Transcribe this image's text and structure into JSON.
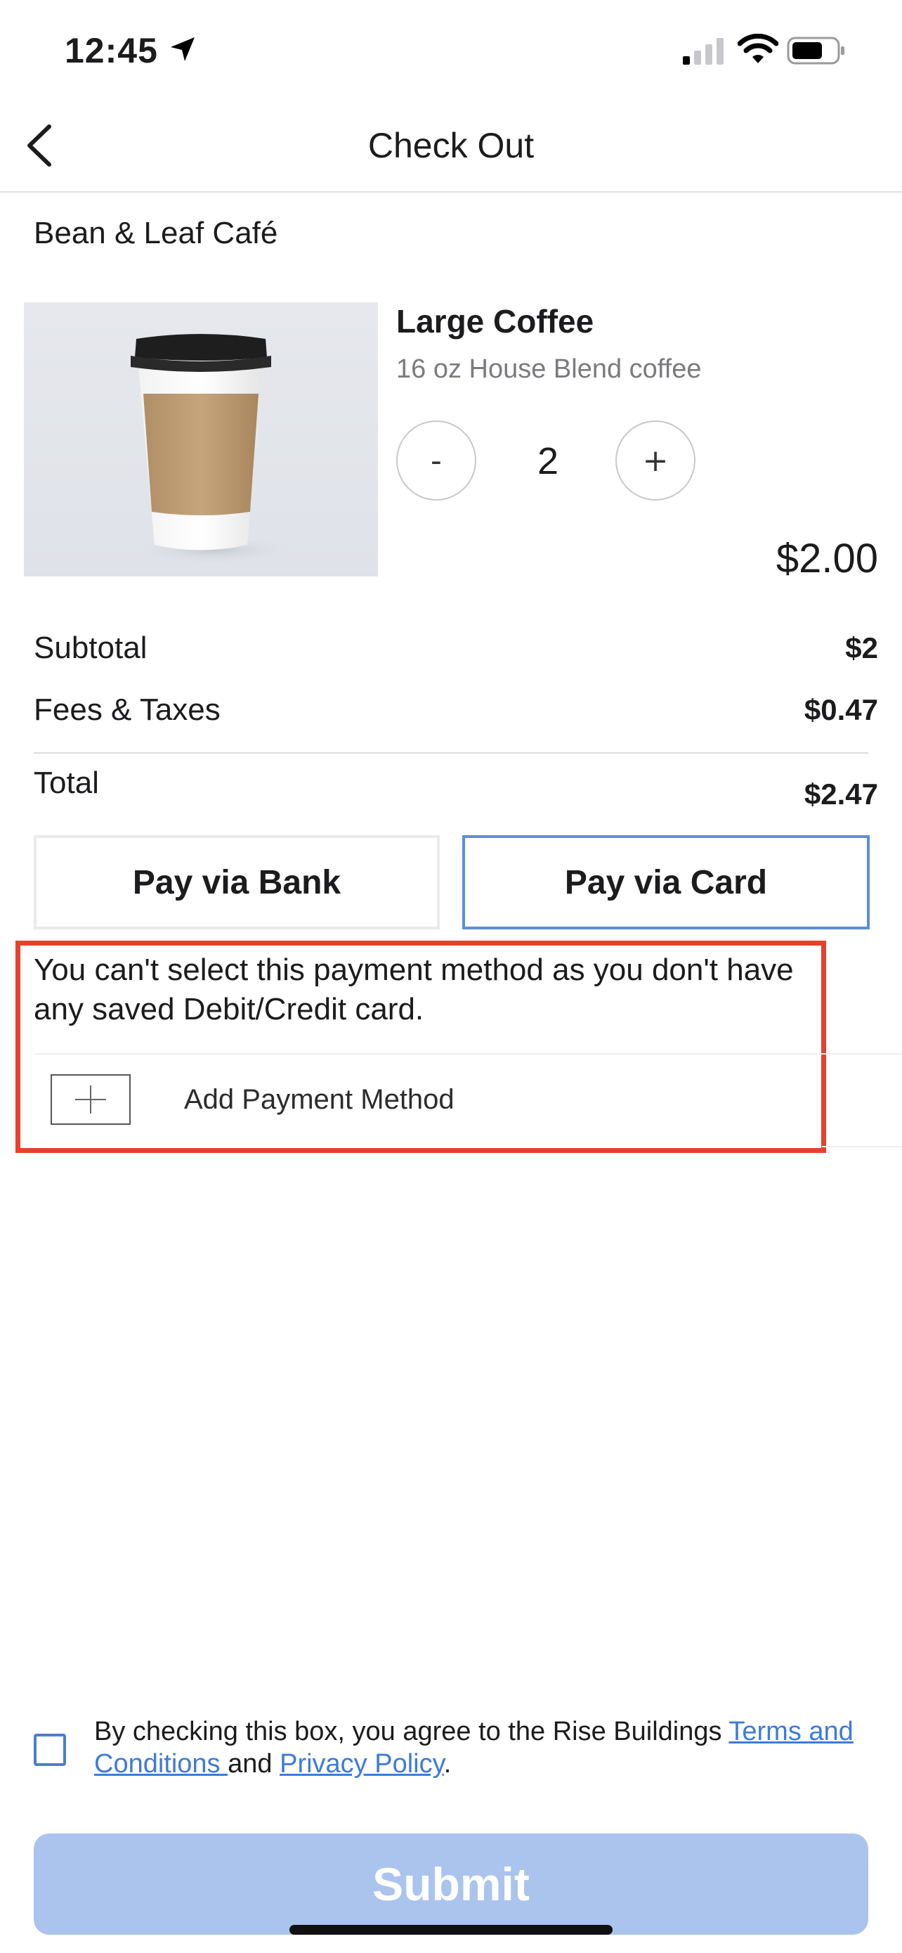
{
  "status_bar": {
    "time": "12:45"
  },
  "nav": {
    "title": "Check Out"
  },
  "store": {
    "name": "Bean & Leaf Café"
  },
  "product": {
    "name": "Large Coffee",
    "description": "16 oz House Blend coffee",
    "quantity": "2",
    "minus_label": "-",
    "plus_label": "+",
    "price": "$2.00"
  },
  "summary": {
    "subtotal_label": "Subtotal",
    "subtotal_value": "$2",
    "fees_label": "Fees & Taxes",
    "fees_value": "$0.47",
    "total_label": "Total",
    "total_value": "$2.47"
  },
  "payment": {
    "bank_label": "Pay via Bank",
    "card_label": "Pay via Card",
    "selected": "card",
    "warning": "You can't select this payment method as you don't have any saved Debit/Credit card.",
    "add_label": "Add Payment Method"
  },
  "terms": {
    "prefix": "By checking this box, you agree to the Rise Buildings ",
    "terms_link": "Terms and Conditions ",
    "and_text": "and ",
    "privacy_link": "Privacy Policy",
    "suffix": ".",
    "checked": false
  },
  "submit": {
    "label": "Submit",
    "enabled": false
  },
  "colors": {
    "accent": "#5b8fd6",
    "warning_border": "#e5412d",
    "submit_disabled": "#aac4ee",
    "link": "#3e7bd9"
  }
}
